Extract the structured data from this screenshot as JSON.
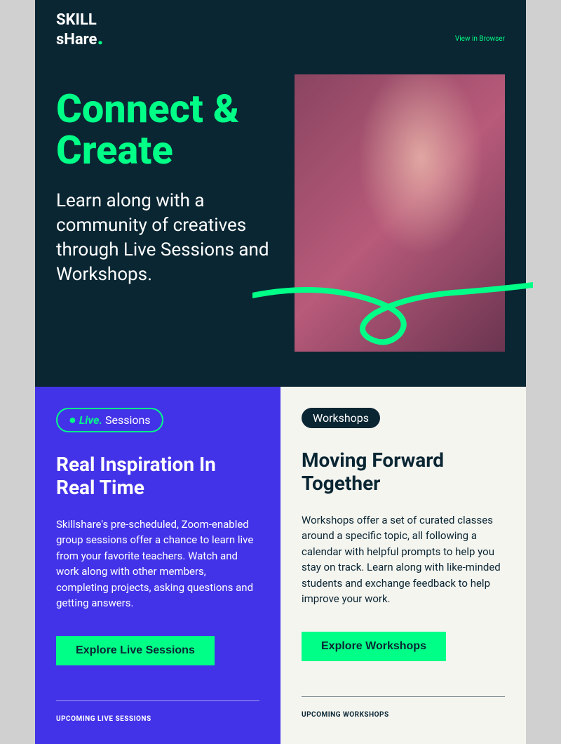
{
  "header": {
    "logo_line1": "SKILL",
    "logo_line2": "sHare",
    "view_browser": "View in Browser"
  },
  "hero": {
    "title": "Connect & Create",
    "subtitle": "Learn along with a community of creatives through Live Sessions and Workshops."
  },
  "left": {
    "badge_live": "Live.",
    "badge_sessions": "Sessions",
    "title": "Real Inspiration In Real Time",
    "description": "Skillshare's pre-scheduled, Zoom-enabled group sessions offer a chance to learn live from your favorite teachers. Watch and work along with other members, completing projects, asking questions and getting answers.",
    "button": "Explore Live Sessions",
    "upcoming": "UPCOMING LIVE SESSIONS"
  },
  "right": {
    "badge": "Workshops",
    "title": "Moving Forward Together",
    "description": "Workshops offer a set of curated classes around a specific topic, all following a calendar with helpful prompts to help you stay on track. Learn along with like-minded students and exchange feedback to help improve your work.",
    "button": "Explore Workshops",
    "upcoming": "UPCOMING WORKSHOPS"
  }
}
